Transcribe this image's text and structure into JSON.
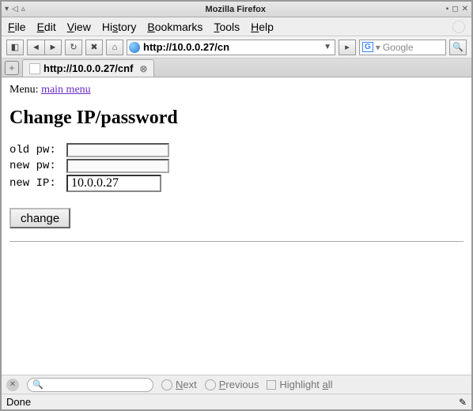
{
  "window": {
    "title": "Mozilla Firefox"
  },
  "menubar": {
    "file": "File",
    "edit": "Edit",
    "view": "View",
    "history": "History",
    "bookmarks": "Bookmarks",
    "tools": "Tools",
    "help": "Help"
  },
  "navbar": {
    "url_display": "http://10.0.0.27/cn",
    "search_placeholder": "Google"
  },
  "tab": {
    "title": "http://10.0.0.27/cnf"
  },
  "page": {
    "menu_label": "Menu:",
    "menu_link": "main menu",
    "heading": "Change IP/password",
    "old_pw_label": "old pw:",
    "new_pw_label": "new pw:",
    "new_ip_label": "new IP:",
    "new_ip_value": "10.0.0.27",
    "change_button": "change"
  },
  "findbar": {
    "next": "Next",
    "previous": "Previous",
    "highlight": "Highlight all"
  },
  "status": {
    "text": "Done"
  }
}
